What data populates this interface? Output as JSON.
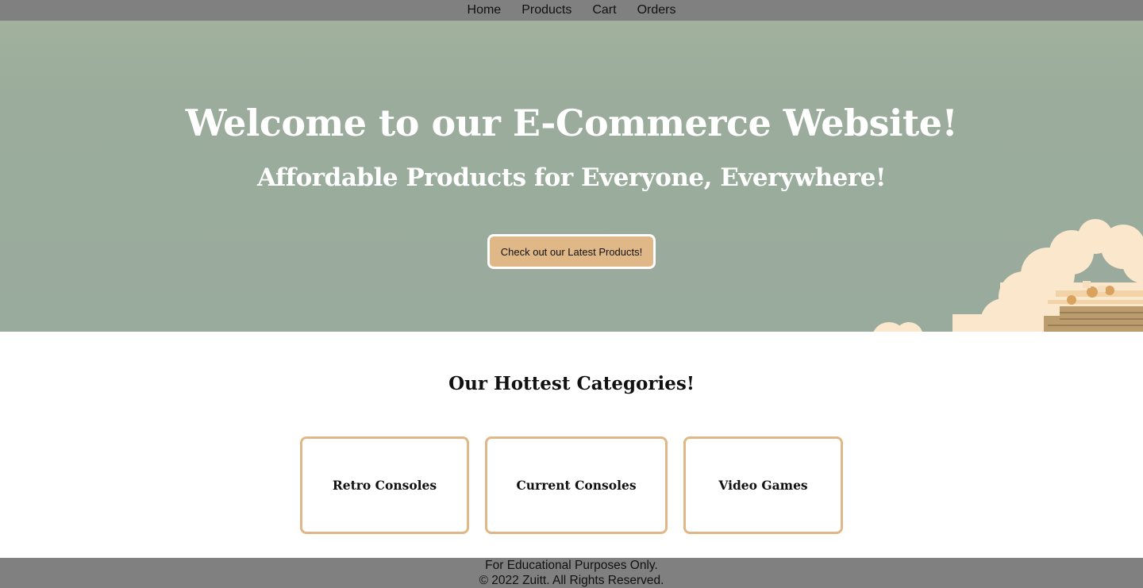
{
  "nav": {
    "links": [
      "Home",
      "Products",
      "Cart",
      "Orders"
    ]
  },
  "hero": {
    "title": "Welcome to our E-Commerce Website!",
    "subtitle": "Affordable Products for Everyone, Everywhere!",
    "cta_label": "Check out our Latest Products!"
  },
  "categories": {
    "title": "Our Hottest Categories!",
    "items": [
      "Retro Consoles",
      "Current Consoles",
      "Video Games"
    ]
  },
  "footer": {
    "line1": "For Educational Purposes Only.",
    "line2": "© 2022 Zuitt. All Rights Reserved."
  },
  "colors": {
    "nav_bg": "#808080",
    "hero_bg": "#9bac9c",
    "accent": "#e0b887",
    "footer_bg": "#808080"
  }
}
